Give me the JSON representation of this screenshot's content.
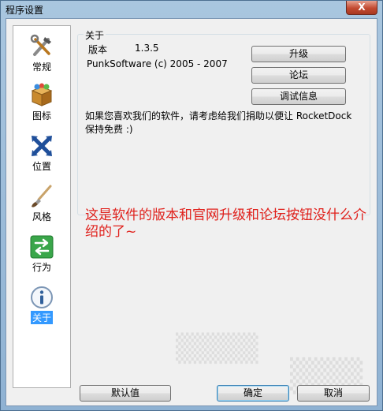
{
  "window": {
    "title": "程序设置",
    "close_glyph": "X"
  },
  "sidebar": {
    "items": [
      {
        "label": "常规",
        "icon": "tools-icon",
        "active": false
      },
      {
        "label": "图标",
        "icon": "box-icon",
        "active": false
      },
      {
        "label": "位置",
        "icon": "arrows-icon",
        "active": false
      },
      {
        "label": "风格",
        "icon": "paintbrush-icon",
        "active": false
      },
      {
        "label": "行为",
        "icon": "exchange-icon",
        "active": false
      },
      {
        "label": "关于",
        "icon": "info-icon",
        "active": true
      }
    ]
  },
  "about": {
    "group_title": "关于",
    "version_label": "版本",
    "version_value": "1.3.5",
    "copyright": "PunkSoftware (c) 2005 - 2007",
    "upgrade_button": "升级",
    "forum_button": "论坛",
    "debug_button": "调试信息",
    "donate_text": "如果您喜欢我们的软件，请考虑给我们捐助以便让 RocketDock 保持免费 :)"
  },
  "annotation": "这是软件的版本和官网升级和论坛按钮没什么介绍的了~",
  "footer": {
    "defaults_button": "默认值",
    "ok_button": "确定",
    "cancel_button": "取消"
  },
  "colors": {
    "accent": "#3399ff",
    "annotation": "#e0201b",
    "close": "#c24a31"
  }
}
